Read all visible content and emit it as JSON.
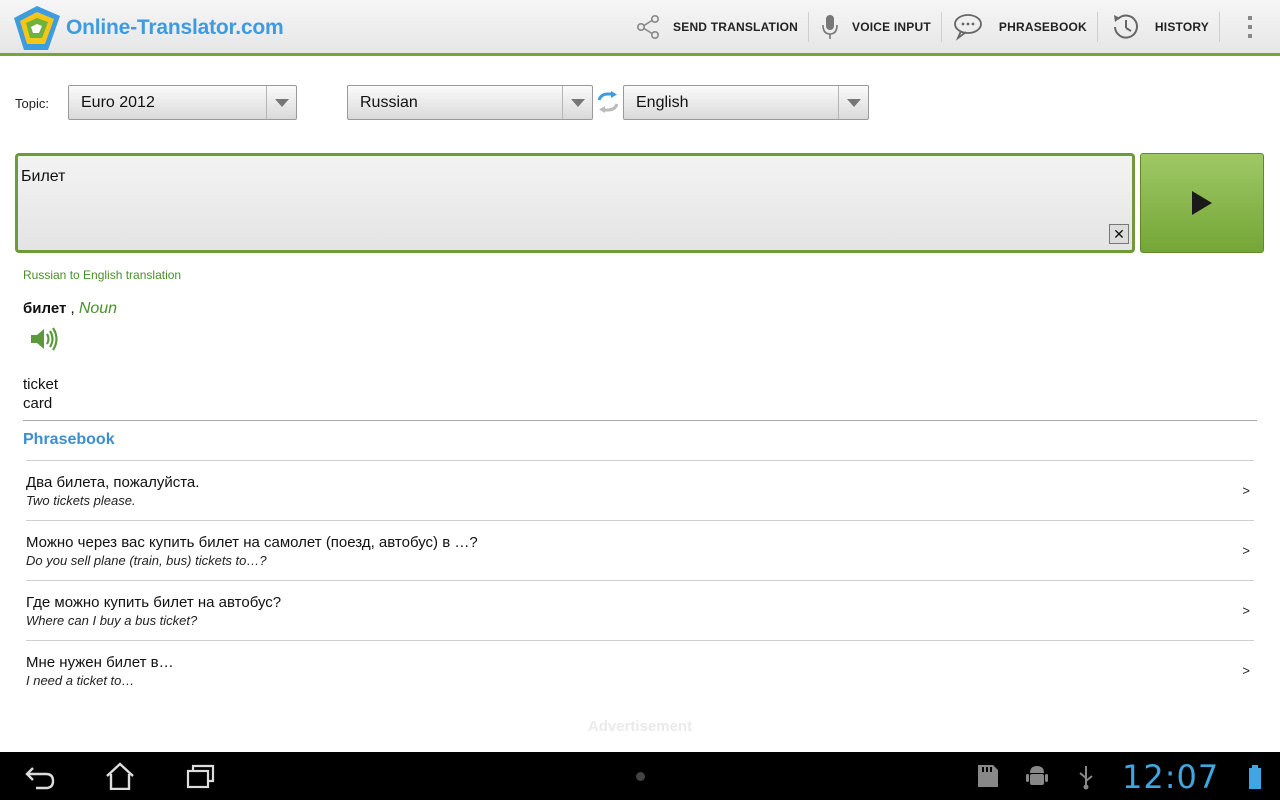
{
  "app": {
    "brand": "Online-Translator.com"
  },
  "actions": [
    {
      "label": "SEND TRANSLATION",
      "icon": "share-icon"
    },
    {
      "label": "VOICE INPUT",
      "icon": "microphone-icon"
    },
    {
      "label": "PHRASEBOOK",
      "icon": "speech-bubbles-icon"
    },
    {
      "label": "HISTORY",
      "icon": "history-clock-icon"
    }
  ],
  "selectors": {
    "topic_label": "Topic:",
    "topic": "Euro 2012",
    "source_lang": "Russian",
    "target_lang": "English"
  },
  "input": {
    "text": "Билет",
    "clear_label": "✕"
  },
  "result": {
    "direction": "Russian to English translation",
    "headword": "билет",
    "separator": " , ",
    "pos": "Noun",
    "meanings": [
      "ticket",
      "card"
    ]
  },
  "phrasebook": {
    "title": "Phrasebook",
    "chevron": ">",
    "items": [
      {
        "ru": "Два билета, пожалуйста.",
        "en": "Two tickets please."
      },
      {
        "ru": "Можно через вас купить билет на самолет (поезд, автобус) в …?",
        "en": "Do you sell plane (train, bus) tickets to…?"
      },
      {
        "ru": "Где можно купить билет на автобус?",
        "en": "Where can I buy a bus ticket?"
      },
      {
        "ru": "Мне нужен билет в…",
        "en": "I need a ticket to…"
      }
    ]
  },
  "ad_label": "Advertisement",
  "system": {
    "clock": "12:07"
  },
  "colors": {
    "accent_green": "#78a53a",
    "brand_blue": "#3d9be0",
    "clock_blue": "#3ea6e0"
  }
}
